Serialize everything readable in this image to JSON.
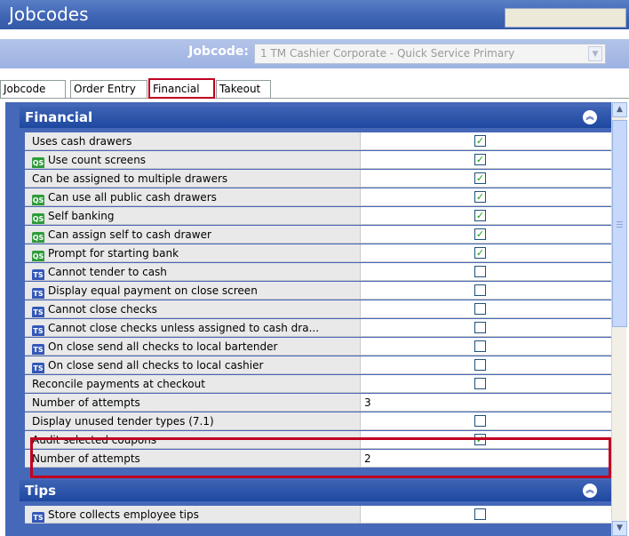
{
  "window": {
    "title": "Jobcodes"
  },
  "jobcode": {
    "label": "Jobcode:",
    "value": "1 TM Cashier Corporate - Quick Service Primary"
  },
  "tabs": [
    {
      "label": "Jobcode"
    },
    {
      "label": "Order Entry"
    },
    {
      "label": "Financial",
      "selected": true
    },
    {
      "label": "Takeout"
    }
  ],
  "sections": {
    "financial": {
      "title": "Financial"
    },
    "tips": {
      "title": "Tips"
    }
  },
  "rows": [
    {
      "label": "Uses cash drawers",
      "badge": "",
      "checked": true
    },
    {
      "label": "Use count screens",
      "badge": "QS",
      "checked": true
    },
    {
      "label": "Can be assigned to multiple drawers",
      "badge": "",
      "checked": true
    },
    {
      "label": "Can use all public cash drawers",
      "badge": "QS",
      "checked": true
    },
    {
      "label": "Self banking",
      "badge": "QS",
      "checked": true
    },
    {
      "label": "Can assign self to cash drawer",
      "badge": "QS",
      "checked": true
    },
    {
      "label": "Prompt for starting bank",
      "badge": "QS",
      "checked": true
    },
    {
      "label": "Cannot tender to cash",
      "badge": "TS",
      "checked": false
    },
    {
      "label": "Display equal payment on close screen",
      "badge": "TS",
      "checked": false
    },
    {
      "label": "Cannot close checks",
      "badge": "TS",
      "checked": false
    },
    {
      "label": "Cannot close checks unless assigned to cash dra...",
      "badge": "TS",
      "checked": false
    },
    {
      "label": "On close send all checks to local bartender",
      "badge": "TS",
      "checked": false
    },
    {
      "label": "On close send all checks to local cashier",
      "badge": "TS",
      "checked": false
    },
    {
      "label": "Reconcile payments at checkout",
      "badge": "",
      "checked": false
    },
    {
      "label": "Number of attempts",
      "badge": "",
      "value": "3"
    },
    {
      "label": "Display unused tender types (7.1)",
      "badge": "",
      "checked": false
    },
    {
      "label": "Audit selected coupons",
      "badge": "",
      "checked": true
    },
    {
      "label": "Number of attempts",
      "badge": "",
      "value": "2"
    }
  ],
  "tips_rows": [
    {
      "label": "Store collects employee tips",
      "badge": "TS",
      "checked": false
    }
  ]
}
